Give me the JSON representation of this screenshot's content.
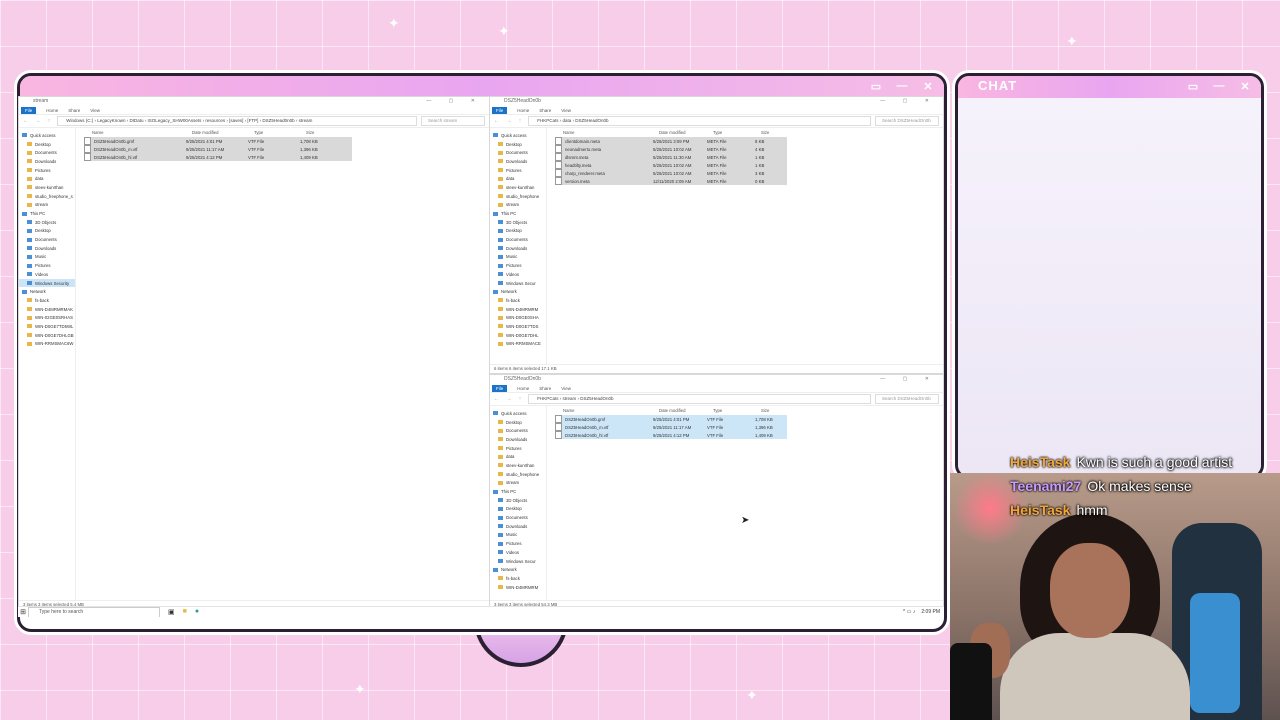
{
  "chat": {
    "title": "CHAT",
    "messages": [
      {
        "user": "HeisTask",
        "text": "Kwn is such a good artist",
        "color": "#f2a63a"
      },
      {
        "user": "Teenami27",
        "text": "Ok makes sense",
        "color": "#c79bff"
      },
      {
        "user": "HeisTask",
        "text": "hmm",
        "color": "#f2a63a"
      }
    ]
  },
  "explorer_left": {
    "title": "stream",
    "ribbon": [
      "File",
      "Home",
      "Share",
      "View"
    ],
    "path": "Windows (C:) › LegacyKnown › DIDatu › ISOLegacy_SHW00Assets › resources › [saves] › [FTP] › DSZ5Head0n0b › stream",
    "search": "Search stream",
    "columns": [
      "Name",
      "Date modified",
      "Type",
      "Size"
    ],
    "files": [
      {
        "name": "DSZ5HeadOn0b.gmf",
        "date": "9/25/2021 4:01 PM",
        "type": "VTF File",
        "size": "1,708 KB"
      },
      {
        "name": "DSZ5HeadOn0b_m.vtf",
        "date": "9/25/2021 11:17 AM",
        "type": "VTF File",
        "size": "1,396 KB"
      },
      {
        "name": "DSZ5HeadOn0b_hl.vtf",
        "date": "9/25/2021 4:12 PM",
        "type": "VTF File",
        "size": "1,409 KB"
      }
    ],
    "nav": [
      {
        "label": "Quick access",
        "head": true
      },
      {
        "label": "Desktop"
      },
      {
        "label": "Documents"
      },
      {
        "label": "Downloads"
      },
      {
        "label": "Pictures"
      },
      {
        "label": "data"
      },
      {
        "label": "steev-kunrthan"
      },
      {
        "label": "studio_freephone_s"
      },
      {
        "label": "stream"
      },
      {
        "label": "This PC",
        "head": true
      },
      {
        "label": "3D Objects"
      },
      {
        "label": "Desktop"
      },
      {
        "label": "Documents"
      },
      {
        "label": "Downloads"
      },
      {
        "label": "Music"
      },
      {
        "label": "Pictures"
      },
      {
        "label": "Videos"
      },
      {
        "label": "Windows Security",
        "sel": true
      },
      {
        "label": "Network",
        "head": true
      },
      {
        "label": "fs-back"
      },
      {
        "label": "WIN-D4MRMRMAK"
      },
      {
        "label": "WIN-02GE0SRHAS"
      },
      {
        "label": "WIN-D0GE7TD5WL"
      },
      {
        "label": "WIN-D0GE7DHLGB"
      },
      {
        "label": "WIN-RRMSMAC6W"
      }
    ],
    "status": "3 items    3 items selected  5.4 MB"
  },
  "explorer_top_right": {
    "title": "DSZ5HeadOn0b",
    "ribbon": [
      "File",
      "Home",
      "Share",
      "View"
    ],
    "path": "FHKPCats › data › DSZ5HeadOn0b",
    "search": "Search DSZ5HeadOn0b",
    "columns": [
      "Name",
      "Date modified",
      "Type",
      "Size"
    ],
    "files": [
      {
        "name": "clientdomain.meta",
        "date": "5/25/2021 3:09 PM",
        "type": "META File",
        "size": "8 KB"
      },
      {
        "name": "neonadmerto.meta",
        "date": "5/25/2021 10:02 AM",
        "type": "META File",
        "size": "4 KB"
      },
      {
        "name": "dlsmnt.meta",
        "date": "5/25/2021 11:30 AM",
        "type": "META File",
        "size": "1 KB"
      },
      {
        "name": "headtilty.meta",
        "date": "5/25/2021 10:02 AM",
        "type": "META File",
        "size": "1 KB"
      },
      {
        "name": "charp_renderer.meta",
        "date": "5/25/2021 10:02 AM",
        "type": "META File",
        "size": "3 KB"
      },
      {
        "name": "version.meta",
        "date": "12/11/2020 2:09 AM",
        "type": "META File",
        "size": "0 KB"
      }
    ],
    "nav": [
      {
        "label": "Quick access",
        "head": true
      },
      {
        "label": "Desktop"
      },
      {
        "label": "Documents"
      },
      {
        "label": "Downloads"
      },
      {
        "label": "Pictures"
      },
      {
        "label": "data"
      },
      {
        "label": "steev-kunrthan"
      },
      {
        "label": "studio_freephone"
      },
      {
        "label": "stream"
      },
      {
        "label": "This PC",
        "head": true
      },
      {
        "label": "3D Objects"
      },
      {
        "label": "Desktop"
      },
      {
        "label": "Documents"
      },
      {
        "label": "Downloads"
      },
      {
        "label": "Music"
      },
      {
        "label": "Pictures"
      },
      {
        "label": "Videos"
      },
      {
        "label": "Windows Secur"
      },
      {
        "label": "Network",
        "head": true
      },
      {
        "label": "fs-back"
      },
      {
        "label": "WIN-D4MRMRM"
      },
      {
        "label": "WIN-D0GE0SHA"
      },
      {
        "label": "WIN-D0GE7TDS"
      },
      {
        "label": "WIN-D0GE7DHL"
      },
      {
        "label": "WIN-RRMSMACE"
      }
    ],
    "status": "6 items    6 items selected  17.1 KB"
  },
  "explorer_bottom_right": {
    "title": "DSZ5HeadOn0b",
    "ribbon": [
      "File",
      "Home",
      "Share",
      "View"
    ],
    "path": "FHKPCats › stream › DSZ5HeadOn0b",
    "search": "Search DSZ5HeadOn0b",
    "columns": [
      "Name",
      "Date modified",
      "Type",
      "Size"
    ],
    "files": [
      {
        "name": "DSZ5HeadOn0b.gmf",
        "date": "9/25/2021 4:01 PM",
        "type": "VTF File",
        "size": "1,708 KB"
      },
      {
        "name": "DSZ5HeadOn0b_m.vtf",
        "date": "9/25/2021 11:17 AM",
        "type": "VTF File",
        "size": "1,396 KB"
      },
      {
        "name": "DSZ5HeadOn0b_hl.vtf",
        "date": "9/25/2021 4:12 PM",
        "type": "VTF File",
        "size": "1,409 KB"
      }
    ],
    "nav": [
      {
        "label": "Quick access",
        "head": true
      },
      {
        "label": "Desktop"
      },
      {
        "label": "Documents"
      },
      {
        "label": "Downloads"
      },
      {
        "label": "Pictures"
      },
      {
        "label": "data"
      },
      {
        "label": "steev-kunrthan"
      },
      {
        "label": "studio_freephone"
      },
      {
        "label": "stream"
      },
      {
        "label": "This PC",
        "head": true
      },
      {
        "label": "3D Objects"
      },
      {
        "label": "Desktop"
      },
      {
        "label": "Documents"
      },
      {
        "label": "Downloads"
      },
      {
        "label": "Music"
      },
      {
        "label": "Pictures"
      },
      {
        "label": "Videos"
      },
      {
        "label": "Windows Secur"
      },
      {
        "label": "Network",
        "head": true
      },
      {
        "label": "fs-back"
      },
      {
        "label": "WIN-D4MRMRM"
      }
    ],
    "status": "3 items    3 items selected  54.3 MB"
  },
  "taskbar": {
    "search_placeholder": "Type here to search",
    "time": "2:09 PM"
  },
  "colors": {
    "background": "#f7cde9",
    "frame_border": "#2a1f33",
    "selection_grey": "#d9d9d9",
    "selection_blue": "#cde6f7"
  }
}
